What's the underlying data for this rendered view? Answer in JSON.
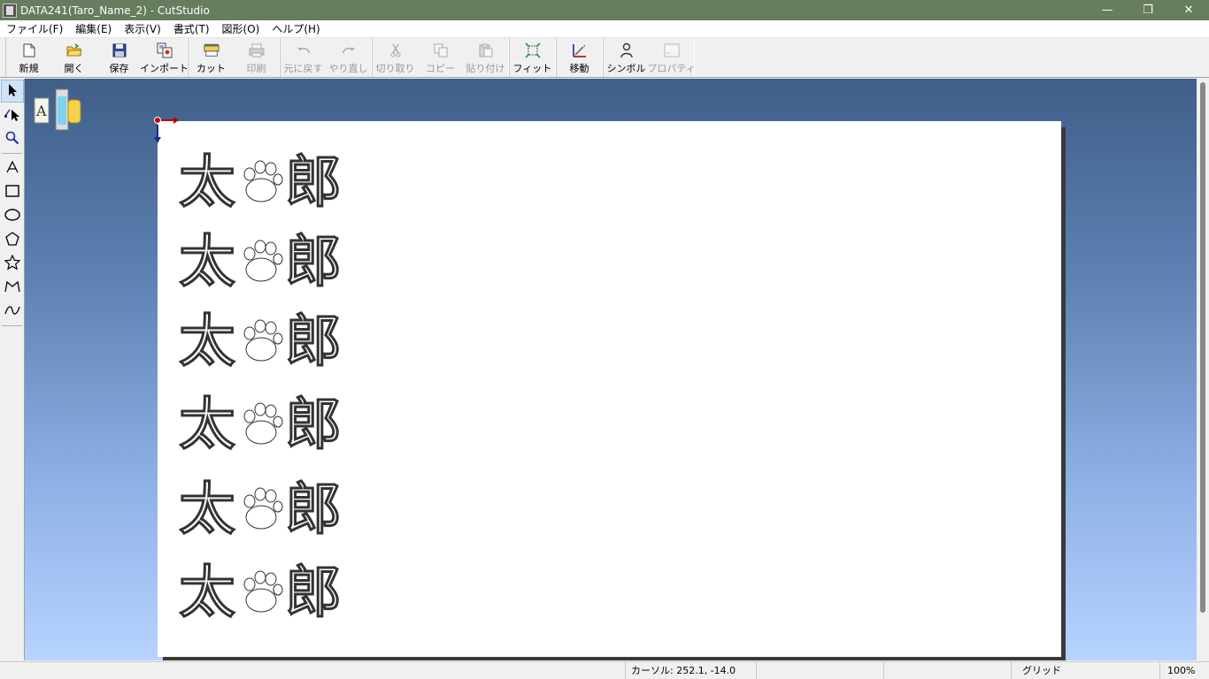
{
  "window": {
    "title": "DATA241(Taro_Name_2) - CutStudio",
    "controls": {
      "minimize": "—",
      "restore": "❐",
      "close": "✕"
    }
  },
  "menu": [
    {
      "label": "ファイル(F)"
    },
    {
      "label": "編集(E)"
    },
    {
      "label": "表示(V)"
    },
    {
      "label": "書式(T)"
    },
    {
      "label": "図形(O)"
    },
    {
      "label": "ヘルプ(H)"
    }
  ],
  "toolbar": {
    "new": "新規",
    "open": "開く",
    "save": "保存",
    "import": "インポート",
    "cut_out": "カット",
    "print": "印刷",
    "undo": "元に戻す",
    "redo": "やり直し",
    "cut": "切り取り",
    "copy": "コピー",
    "paste": "貼り付け",
    "fit": "フィット",
    "move": "移動",
    "symbol": "シンボル",
    "properties": "プロパティ"
  },
  "canvas": {
    "name_rows": [
      {
        "left": "太",
        "right": "郎"
      },
      {
        "left": "太",
        "right": "郎"
      },
      {
        "left": "太",
        "right": "郎"
      },
      {
        "left": "太",
        "right": "郎"
      },
      {
        "left": "太",
        "right": "郎"
      },
      {
        "left": "太",
        "right": "郎"
      }
    ]
  },
  "status": {
    "cursor": "カーソル: 252.1, -14.0 mm",
    "grid": "グリッド",
    "zoom": "100%"
  },
  "colors": {
    "titlebar": "#667d5e",
    "origin_x_arrow": "#c00000",
    "origin_y_arrow": "#1a2a9a"
  }
}
